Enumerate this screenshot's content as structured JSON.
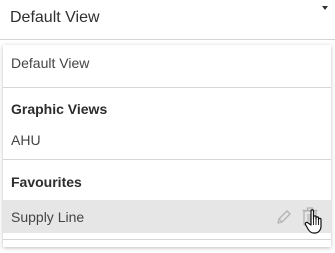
{
  "dropdown": {
    "selected_value": "Default View"
  },
  "menu": {
    "default_item": "Default View",
    "groups": [
      {
        "title": "Graphic Views",
        "items": [
          "AHU"
        ]
      },
      {
        "title": "Favourites",
        "items": [
          "Supply Line"
        ]
      }
    ]
  },
  "icons": {
    "caret": "chevron-down-icon",
    "edit": "pencil-icon",
    "delete": "trash-icon",
    "cursor": "hand-cursor-icon"
  },
  "colors": {
    "selected_row_bg": "#e6e6e6",
    "icon_gray": "#b3b3b3",
    "divider": "#d6d6d6"
  }
}
